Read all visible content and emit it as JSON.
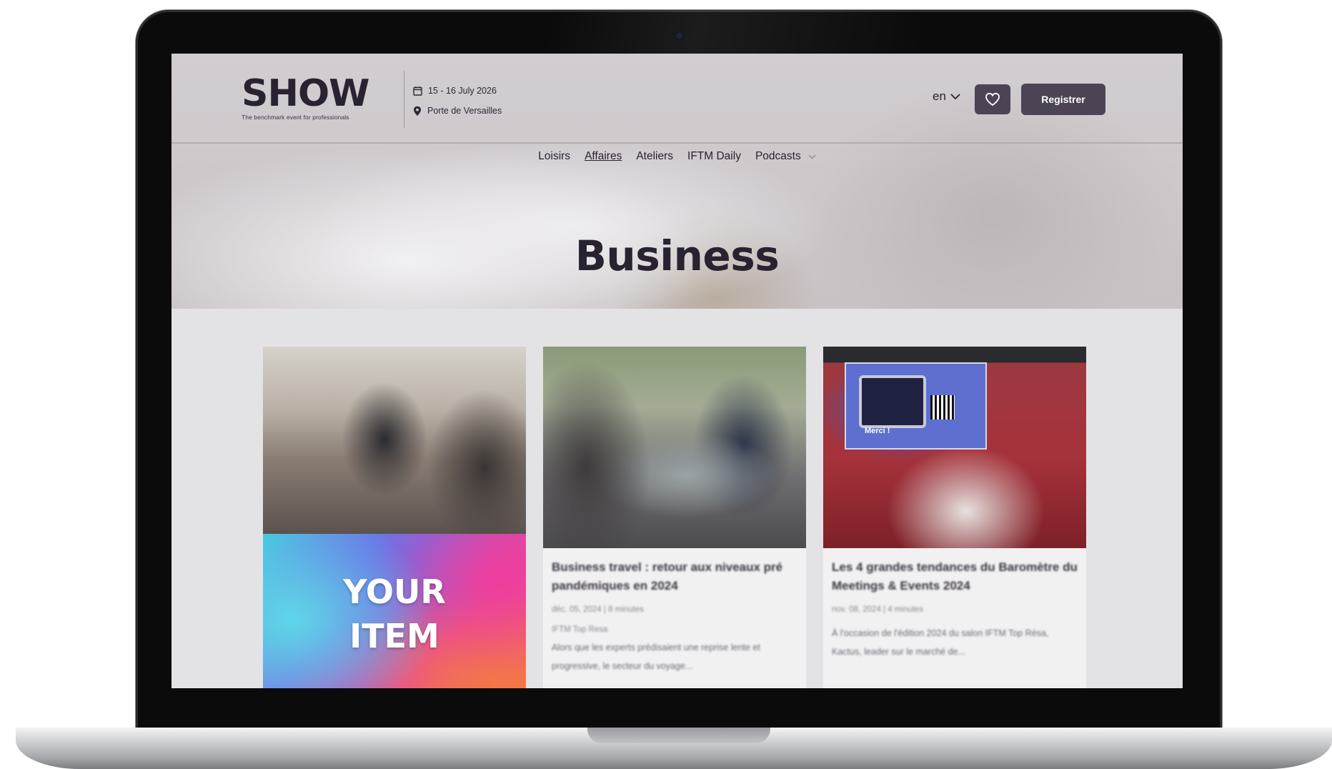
{
  "brand": {
    "name": "SHOW",
    "tagline": "The benchmark event for professionals"
  },
  "event": {
    "dates": "15 - 16 July 2026",
    "location": "Porte de Versailles"
  },
  "header": {
    "language": "en",
    "register_label": "Registrer"
  },
  "nav": {
    "items": [
      {
        "label": "Loisirs",
        "active": false
      },
      {
        "label": "Affaires",
        "active": true
      },
      {
        "label": "Ateliers",
        "active": false
      },
      {
        "label": "IFTM Daily",
        "active": false
      },
      {
        "label": "Podcasts",
        "active": false
      }
    ]
  },
  "page": {
    "title": "Business"
  },
  "cards": [
    {
      "promo_line1": "YOUR",
      "promo_line2": "ITEM"
    },
    {
      "title": "Business travel : retour aux niveaux pré pandémiques en 2024",
      "meta": "déc. 05, 2024  |  8 minutes",
      "category": "IFTM Top Resa",
      "excerpt": "Alors que les experts prédisaient une reprise lente et progressive, le secteur du voyage..."
    },
    {
      "screen_text": "Merci !",
      "title": "Les 4 grandes tendances du Baromètre du Meetings & Events 2024",
      "meta": "nov. 08, 2024  |  4 minutes",
      "excerpt": "À l'occasion de l'édition 2024 du salon IFTM Top Résa, Kactus, leader sur le marché de..."
    }
  ],
  "colors": {
    "brand_dark": "#2a2230",
    "button_bg": "#4c4455",
    "button_text": "#ffffff"
  }
}
